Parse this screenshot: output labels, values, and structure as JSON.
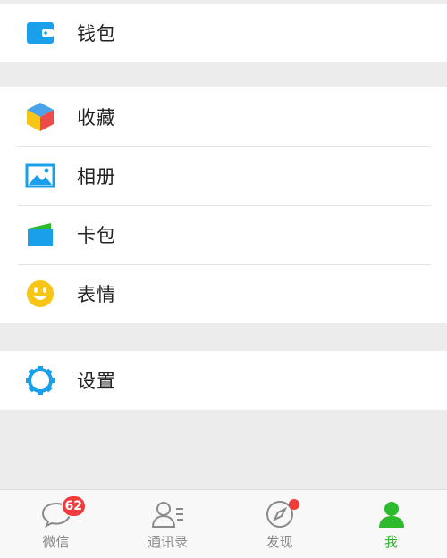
{
  "groups": [
    {
      "items": [
        {
          "label": "钱包",
          "icon": "wallet-icon"
        }
      ]
    },
    {
      "items": [
        {
          "label": "收藏",
          "icon": "favorites-cube-icon"
        },
        {
          "label": "相册",
          "icon": "photo-album-icon"
        },
        {
          "label": "卡包",
          "icon": "card-wallet-icon"
        },
        {
          "label": "表情",
          "icon": "smiley-icon"
        }
      ]
    },
    {
      "items": [
        {
          "label": "设置",
          "icon": "settings-gear-icon"
        }
      ]
    }
  ],
  "tabbar": {
    "tabs": [
      {
        "label": "微信",
        "icon": "chat-bubble-icon",
        "badge": "62"
      },
      {
        "label": "通讯录",
        "icon": "contacts-icon"
      },
      {
        "label": "发现",
        "icon": "compass-icon"
      },
      {
        "label": "我",
        "icon": "me-person-icon"
      }
    ],
    "active_index": 3
  },
  "colors": {
    "background": "#ececec",
    "accent_green": "#2dba2d",
    "badge_red": "#f23b3b",
    "icon_blue": "#1aa0ea",
    "smiley_yellow": "#f7c516"
  }
}
